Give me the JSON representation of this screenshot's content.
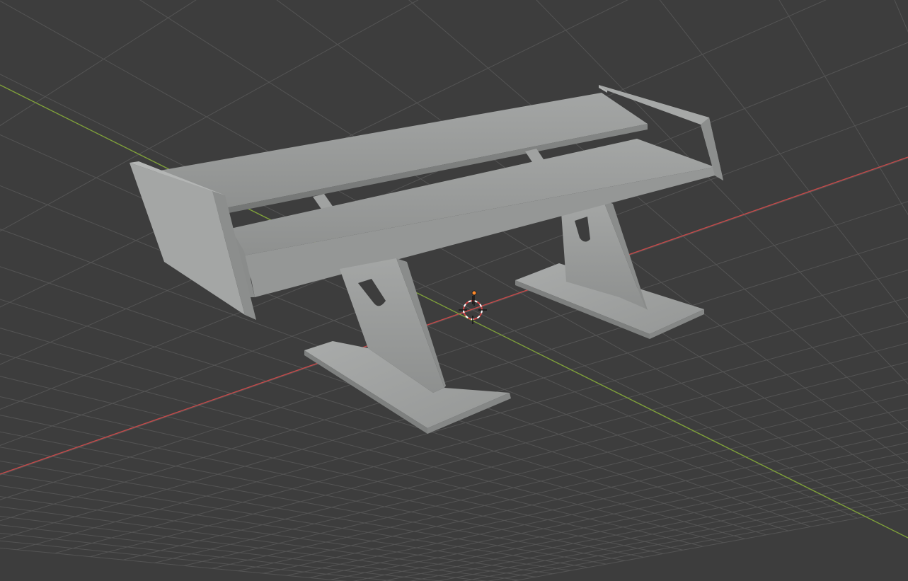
{
  "viewport": {
    "background": "#3d3d3d",
    "grid_color": "#545454",
    "x_axis_color": "#c54a4a",
    "y_axis_color": "#7fa03a"
  },
  "scene": {
    "object_color": "#9a9c9b",
    "cursor_icon": "3d-cursor-icon",
    "origin_color": "#ff8a2a"
  }
}
